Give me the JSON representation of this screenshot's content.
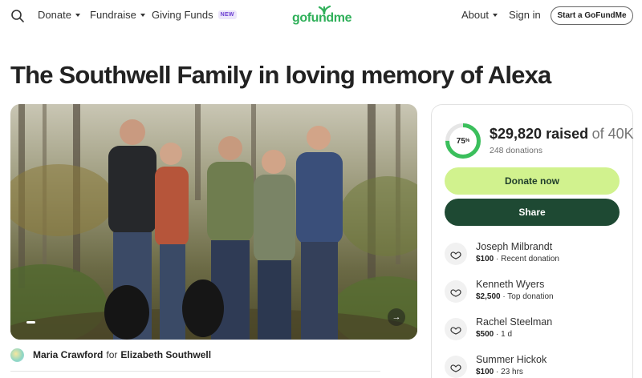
{
  "header": {
    "nav": {
      "donate": "Donate",
      "fundraise": "Fundraise",
      "giving_funds": "Giving Funds",
      "new_badge": "NEW",
      "about": "About",
      "sign_in": "Sign in"
    },
    "logo_text": "gofundme",
    "start_button": "Start a GoFundMe"
  },
  "page": {
    "title": "The Southwell Family in loving memory of Alexa"
  },
  "organizer": {
    "name": "Maria Crawford",
    "for_word": "for",
    "beneficiary": "Elizabeth Southwell"
  },
  "campaign": {
    "progress_percent": 75,
    "progress_label_number": "75",
    "progress_label_sign": "%",
    "raised_amount": "$29,820 raised",
    "goal_text": "of 40K",
    "donations_count": "248 donations",
    "donate_button": "Donate now",
    "share_button": "Share"
  },
  "donations": [
    {
      "name": "Joseph Milbrandt",
      "amount": "$100",
      "note": "· Recent donation"
    },
    {
      "name": "Kenneth Wyers",
      "amount": "$2,500",
      "note": "· Top donation"
    },
    {
      "name": "Rachel Steelman",
      "amount": "$500",
      "note": "· 1 d"
    },
    {
      "name": "Summer Hickok",
      "amount": "$100",
      "note": "· 23 hrs"
    }
  ],
  "colors": {
    "brand_green": "#30b05a",
    "donate_button_bg": "#d1f28e",
    "share_button_bg": "#1e4933",
    "progress_ring": "#3bbf5c"
  },
  "icons": {
    "search": "search-icon",
    "next": "arrow-right-icon",
    "donor": "heart-hand-icon"
  }
}
